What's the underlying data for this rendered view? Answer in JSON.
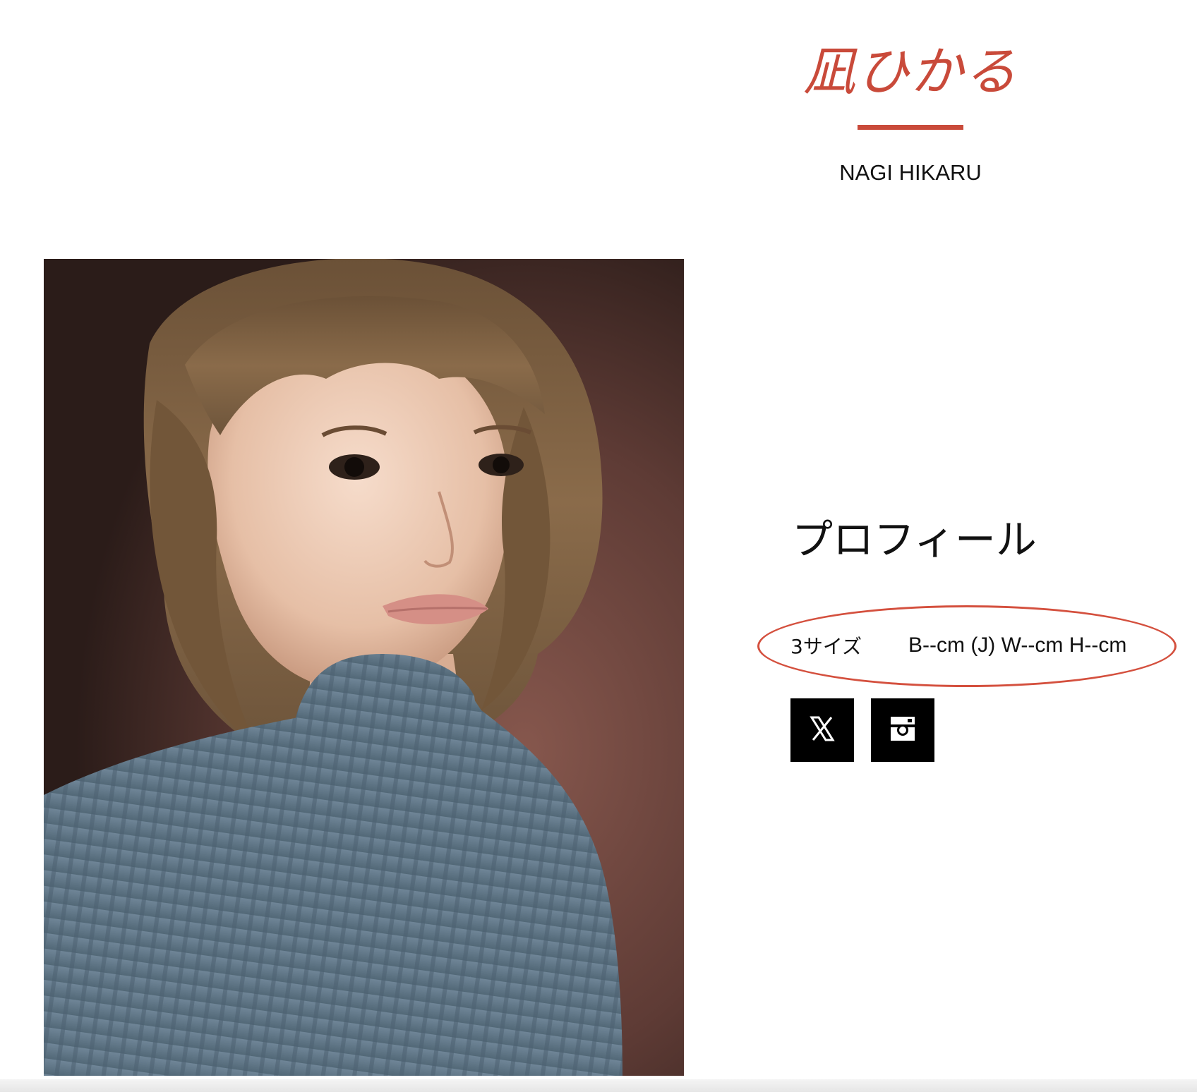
{
  "header": {
    "name_jp": "凪ひかる",
    "name_en": "NAGI HIKARU"
  },
  "portrait": {
    "description_icon": "portrait-photo"
  },
  "profile": {
    "heading": "プロフィール",
    "three_sizes_label": "3サイズ",
    "three_sizes_value": "B--cm (J) W--cm H--cm"
  },
  "social": {
    "x_icon": "x-icon",
    "instagram_icon": "instagram-icon"
  },
  "colors": {
    "accent": "#c94a3a",
    "annotation": "#d4503e",
    "icon_bg": "#000000"
  }
}
